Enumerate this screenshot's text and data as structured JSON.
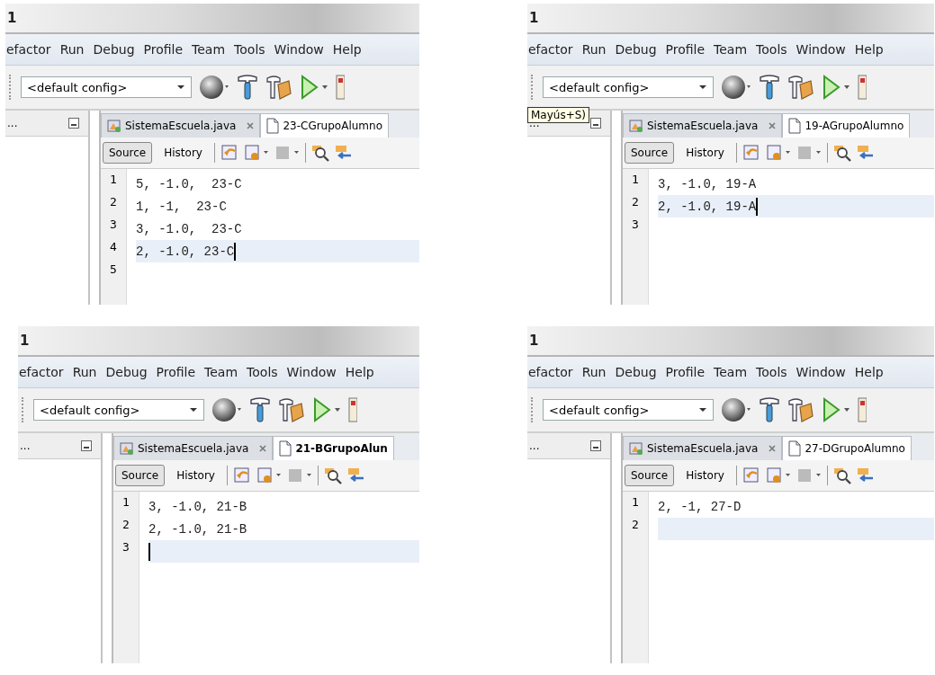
{
  "panels": [
    {
      "title": "1",
      "menu": [
        "efactor",
        "Run",
        "Debug",
        "Profile",
        "Team",
        "Tools",
        "Window",
        "Help"
      ],
      "config": "<default config>",
      "sidebar_label": "...",
      "tabs": [
        {
          "label": "SistemaEscuela.java",
          "kind": "java",
          "selected": false,
          "modified": false
        },
        {
          "label": "23-CGrupoAlumno",
          "kind": "text",
          "selected": true,
          "modified": false
        }
      ],
      "views": [
        {
          "label": "Source",
          "selected": true
        },
        {
          "label": "History",
          "selected": false
        }
      ],
      "lines": [
        {
          "number": "1",
          "text": "5, -1.0,  23-C",
          "current": false,
          "cursor": false
        },
        {
          "number": "2",
          "text": "1, -1,  23-C",
          "current": false,
          "cursor": false
        },
        {
          "number": "3",
          "text": "3, -1.0,  23-C",
          "current": false,
          "cursor": false
        },
        {
          "number": "4",
          "text": "2, -1.0, 23-C",
          "current": true,
          "cursor": true
        },
        {
          "number": "5",
          "current": false,
          "cursor": false
        }
      ]
    },
    {
      "title": "1",
      "menu": [
        "efactor",
        "Run",
        "Debug",
        "Profile",
        "Team",
        "Tools",
        "Window",
        "Help"
      ],
      "config": "<default config>",
      "tooltip": "Mayús+S)",
      "sidebar_label": "...",
      "tabs": [
        {
          "label": "SistemaEscuela.java",
          "kind": "java",
          "selected": false,
          "modified": false
        },
        {
          "label": "19-AGrupoAlumno",
          "kind": "text",
          "selected": true,
          "modified": false
        }
      ],
      "views": [
        {
          "label": "Source",
          "selected": true
        },
        {
          "label": "History",
          "selected": false
        }
      ],
      "lines": [
        {
          "number": "1",
          "text": "3, -1.0, 19-A",
          "current": false,
          "cursor": false
        },
        {
          "number": "2",
          "text": "2, -1.0, 19-A",
          "current": true,
          "cursor": true
        },
        {
          "number": "3",
          "current": false,
          "cursor": false
        }
      ]
    },
    {
      "title": "1",
      "menu": [
        "efactor",
        "Run",
        "Debug",
        "Profile",
        "Team",
        "Tools",
        "Window",
        "Help"
      ],
      "config": "<default config>",
      "sidebar_label": "...",
      "tabs": [
        {
          "label": "SistemaEscuela.java",
          "kind": "java",
          "selected": false,
          "modified": false
        },
        {
          "label": "21-BGrupoAlun",
          "kind": "text",
          "selected": true,
          "modified": true
        }
      ],
      "views": [
        {
          "label": "Source",
          "selected": true
        },
        {
          "label": "History",
          "selected": false
        }
      ],
      "lines": [
        {
          "number": "1",
          "text": "3, -1.0, 21-B",
          "current": false,
          "cursor": false
        },
        {
          "number": "2",
          "text": "2, -1.0, 21-B",
          "current": false,
          "cursor": false
        },
        {
          "number": "3",
          "current": true,
          "cursor": true
        }
      ]
    },
    {
      "title": "1",
      "menu": [
        "efactor",
        "Run",
        "Debug",
        "Profile",
        "Team",
        "Tools",
        "Window",
        "Help"
      ],
      "config": "<default config>",
      "sidebar_label": "...",
      "tabs": [
        {
          "label": "SistemaEscuela.java",
          "kind": "java",
          "selected": false,
          "modified": false
        },
        {
          "label": "27-DGrupoAlumno",
          "kind": "text",
          "selected": true,
          "modified": false
        }
      ],
      "views": [
        {
          "label": "Source",
          "selected": true
        },
        {
          "label": "History",
          "selected": false
        }
      ],
      "lines": [
        {
          "number": "1",
          "text": "2, -1, 27-D",
          "current": false,
          "cursor": false
        },
        {
          "number": "2",
          "current": true,
          "cursor": false
        }
      ]
    }
  ]
}
